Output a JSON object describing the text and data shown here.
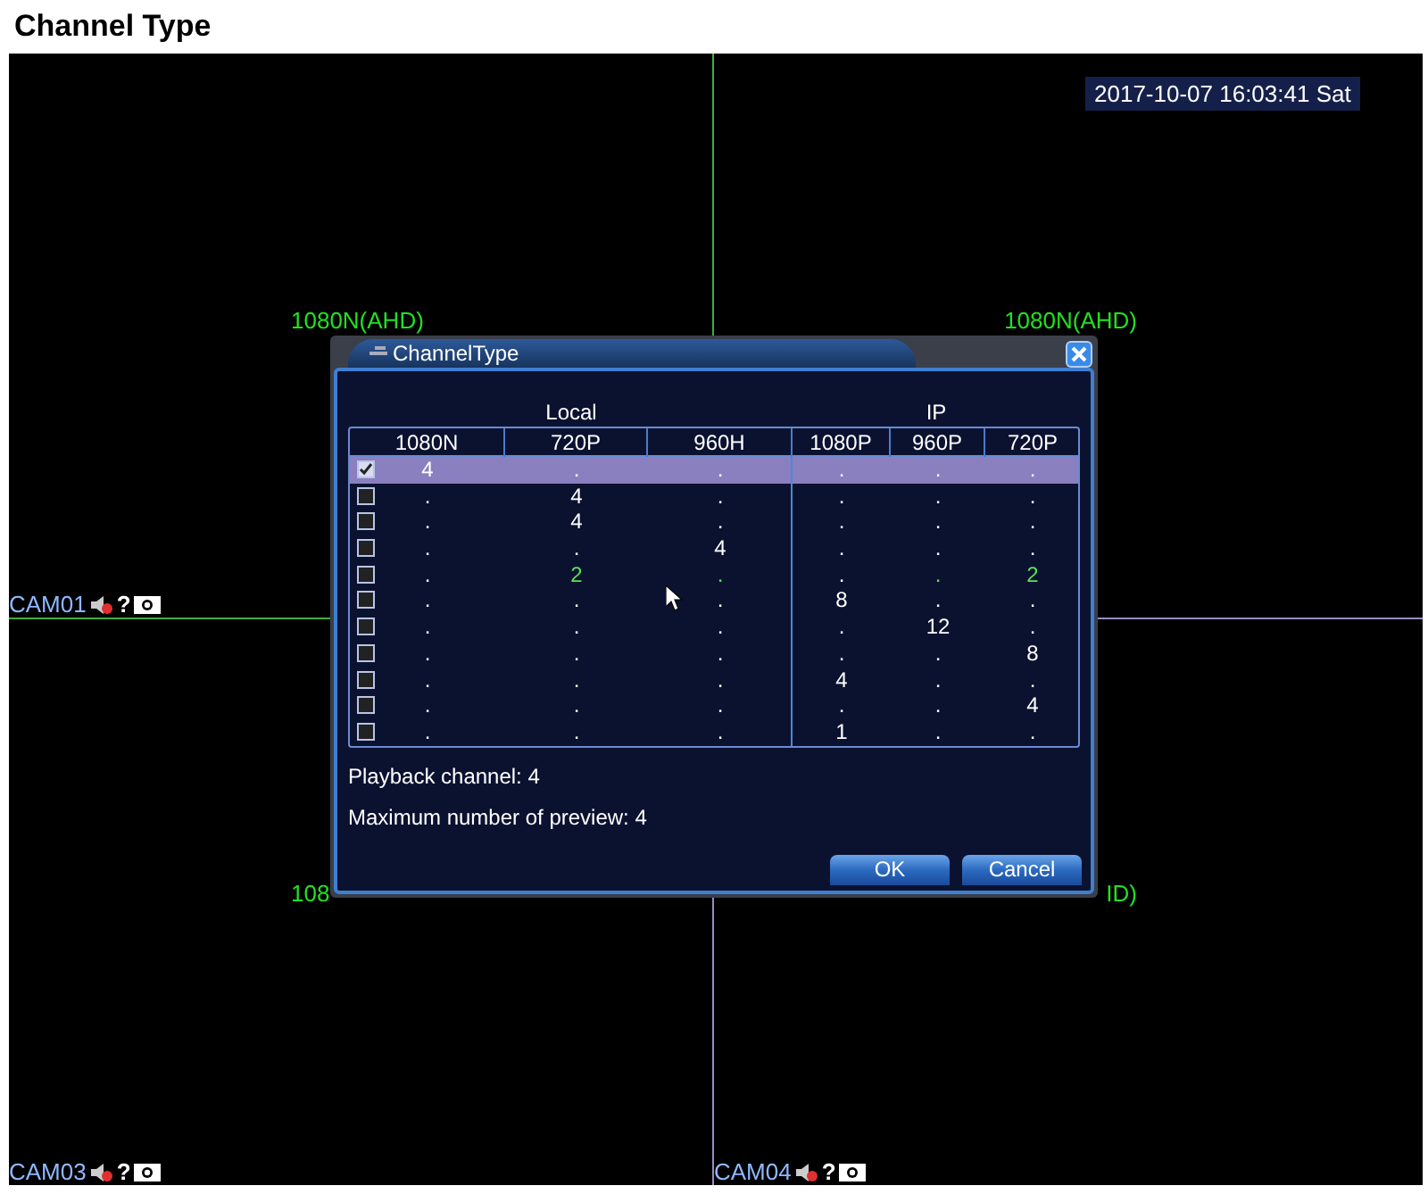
{
  "page_title": "Channel Type",
  "timestamp": "2017-10-07 16:03:41 Sat",
  "quadrants": [
    {
      "camera": "CAM01",
      "help": "?",
      "resolution": "1080N(AHD)"
    },
    {
      "resolution": "1080N(AHD)"
    },
    {
      "camera": "CAM03",
      "help": "?",
      "resolution": "108"
    },
    {
      "camera": "CAM04",
      "help": "?",
      "resolution": "ID)"
    }
  ],
  "dialog": {
    "title": "ChannelType",
    "groups": [
      "Local",
      "IP"
    ],
    "columns": [
      "1080N",
      "720P",
      "960H",
      "1080P",
      "960P",
      "720P"
    ],
    "rows": [
      {
        "checked": true,
        "selected": true,
        "cells": [
          "4",
          ".",
          ".",
          ".",
          ".",
          "."
        ]
      },
      {
        "checked": false,
        "selected": false,
        "cells": [
          ".",
          "4",
          ".",
          ".",
          ".",
          "."
        ]
      },
      {
        "checked": false,
        "selected": false,
        "cells": [
          ".",
          "4",
          ".",
          ".",
          ".",
          "."
        ]
      },
      {
        "checked": false,
        "selected": false,
        "cells": [
          ".",
          ".",
          "4",
          ".",
          ".",
          "."
        ]
      },
      {
        "checked": false,
        "selected": false,
        "cells": [
          ".",
          "2",
          ".",
          ".",
          ".",
          "2"
        ],
        "highlighted": [
          false,
          true,
          true,
          false,
          true,
          true
        ]
      },
      {
        "checked": false,
        "selected": false,
        "cells": [
          ".",
          ".",
          ".",
          "8",
          ".",
          "."
        ]
      },
      {
        "checked": false,
        "selected": false,
        "cells": [
          ".",
          ".",
          ".",
          ".",
          "12",
          "."
        ]
      },
      {
        "checked": false,
        "selected": false,
        "cells": [
          ".",
          ".",
          ".",
          ".",
          ".",
          "8"
        ]
      },
      {
        "checked": false,
        "selected": false,
        "cells": [
          ".",
          ".",
          ".",
          "4",
          ".",
          "."
        ]
      },
      {
        "checked": false,
        "selected": false,
        "cells": [
          ".",
          ".",
          ".",
          ".",
          ".",
          "4"
        ]
      },
      {
        "checked": false,
        "selected": false,
        "cells": [
          ".",
          ".",
          ".",
          "1",
          ".",
          "."
        ]
      }
    ],
    "info": [
      "Playback channel: 4",
      "Maximum number of preview: 4"
    ],
    "buttons": [
      "OK",
      "Cancel"
    ]
  }
}
